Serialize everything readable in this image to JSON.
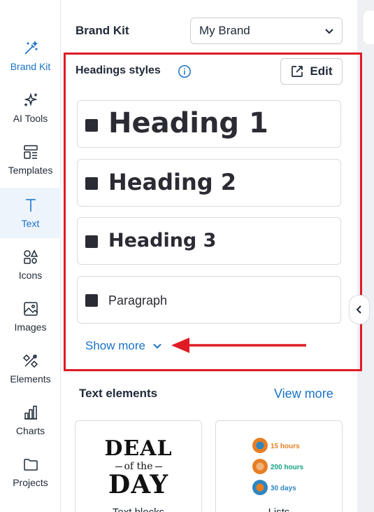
{
  "rail": {
    "items": [
      {
        "label": "Brand Kit"
      },
      {
        "label": "AI Tools"
      },
      {
        "label": "Templates"
      },
      {
        "label": "Text"
      },
      {
        "label": "Icons"
      },
      {
        "label": "Images"
      },
      {
        "label": "Elements"
      },
      {
        "label": "Charts"
      },
      {
        "label": "Projects"
      }
    ]
  },
  "brand_kit": {
    "title": "Brand Kit",
    "selected_brand": "My Brand"
  },
  "headings_styles": {
    "title": "Headings styles",
    "edit_label": "Edit",
    "styles": [
      {
        "label": "Heading 1"
      },
      {
        "label": "Heading 2"
      },
      {
        "label": "Heading 3"
      },
      {
        "label": "Paragraph"
      }
    ],
    "show_more_label": "Show more"
  },
  "text_elements": {
    "title": "Text elements",
    "view_more_label": "View more",
    "thumbs": [
      {
        "caption": "Text blocks",
        "deal_line1": "DEAL",
        "deal_line2": "of the",
        "deal_line3": "DAY"
      },
      {
        "caption": "Lists",
        "rows": [
          {
            "text": "15 hours",
            "color": "#e67e22"
          },
          {
            "text": "200 hours",
            "color": "#16a085"
          },
          {
            "text": "30 days",
            "color": "#2e86c1"
          }
        ]
      }
    ]
  },
  "colors": {
    "accent": "#1a73c8",
    "highlight": "#e01b24",
    "swatch": "#2b2b33"
  }
}
